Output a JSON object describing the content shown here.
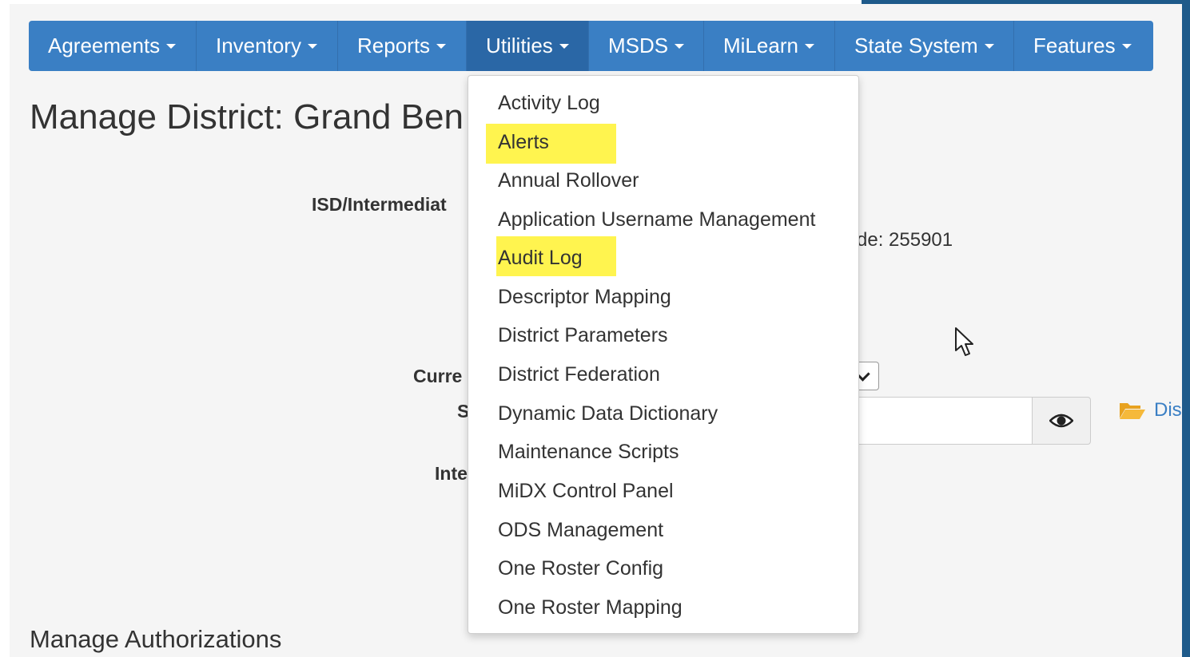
{
  "nav": {
    "items": [
      {
        "label": "Agreements"
      },
      {
        "label": "Inventory"
      },
      {
        "label": "Reports"
      },
      {
        "label": "Utilities"
      },
      {
        "label": "MSDS"
      },
      {
        "label": "MiLearn"
      },
      {
        "label": "State System"
      },
      {
        "label": "Features"
      }
    ],
    "active": "Utilities"
  },
  "page": {
    "title": "Manage District: Grand Ben",
    "isd_label": "ISD/Intermediat",
    "code_text": "de: 255901",
    "current_label": "Curre",
    "s_label": "S",
    "inte_label": "Inte",
    "dis_link": "Dis",
    "section_title": "Manage Authorizations"
  },
  "utilities_menu": {
    "items": [
      {
        "label": "Activity Log",
        "highlighted": false
      },
      {
        "label": "Alerts",
        "highlighted": true
      },
      {
        "label": "Annual Rollover",
        "highlighted": false
      },
      {
        "label": "Application Username Management",
        "highlighted": false
      },
      {
        "label": "Audit Log",
        "highlighted": true
      },
      {
        "label": "Descriptor Mapping",
        "highlighted": false
      },
      {
        "label": "District Parameters",
        "highlighted": false
      },
      {
        "label": "District Federation",
        "highlighted": false
      },
      {
        "label": "Dynamic Data Dictionary",
        "highlighted": false
      },
      {
        "label": "Maintenance Scripts",
        "highlighted": false
      },
      {
        "label": "MiDX Control Panel",
        "highlighted": false
      },
      {
        "label": "ODS Management",
        "highlighted": false
      },
      {
        "label": "One Roster Config",
        "highlighted": false
      },
      {
        "label": "One Roster Mapping",
        "highlighted": false
      }
    ]
  },
  "colors": {
    "navbar": "#3a7fc4",
    "navbar_active": "#2a67a6",
    "highlight": "#fff44f",
    "link": "#3a7fc4",
    "folder": "#f0ad2e"
  },
  "icons": {
    "eye": "eye-icon",
    "folder": "folder-open-icon",
    "cursor": "mouse-pointer-icon"
  }
}
